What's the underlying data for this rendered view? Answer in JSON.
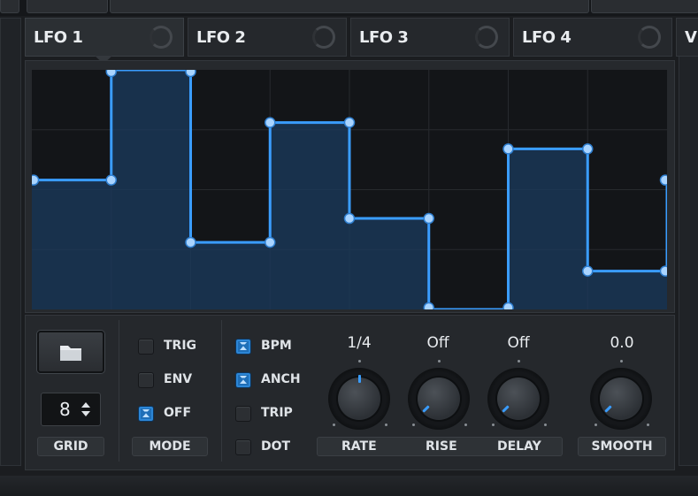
{
  "tabs": [
    {
      "label": "LFO 1",
      "active": true
    },
    {
      "label": "LFO 2",
      "active": false
    },
    {
      "label": "LFO 3",
      "active": false
    },
    {
      "label": "LFO 4",
      "active": false
    },
    {
      "label": "V",
      "active": false
    }
  ],
  "lfo_shape": {
    "points": [
      [
        0.0,
        0.54
      ],
      [
        0.125,
        0.54
      ],
      [
        0.125,
        1.0
      ],
      [
        0.25,
        1.0
      ],
      [
        0.25,
        0.28
      ],
      [
        0.375,
        0.28
      ],
      [
        0.375,
        0.78
      ],
      [
        0.5,
        0.78
      ],
      [
        0.5,
        0.38
      ],
      [
        0.625,
        0.38
      ],
      [
        0.625,
        0.0
      ],
      [
        0.75,
        0.0
      ],
      [
        0.75,
        0.67
      ],
      [
        0.875,
        0.67
      ],
      [
        0.875,
        0.16
      ],
      [
        1.0,
        0.16
      ],
      [
        1.0,
        0.54
      ]
    ]
  },
  "grid": {
    "value": "8",
    "label": "GRID"
  },
  "mode": {
    "label": "MODE",
    "options": [
      {
        "label": "TRIG",
        "checked": false
      },
      {
        "label": "ENV",
        "checked": false
      },
      {
        "label": "OFF",
        "checked": true
      }
    ]
  },
  "sync": {
    "options": [
      {
        "label": "BPM",
        "checked": true
      },
      {
        "label": "ANCH",
        "checked": true
      },
      {
        "label": "TRIP",
        "checked": false
      },
      {
        "label": "DOT",
        "checked": false
      }
    ]
  },
  "knobs": [
    {
      "value": "1/4",
      "label": "RATE"
    },
    {
      "value": "Off",
      "label": "RISE"
    },
    {
      "value": "Off",
      "label": "DELAY"
    },
    {
      "value": "0.0",
      "label": "SMOOTH"
    }
  ],
  "colors": {
    "accent": "#3a9dff",
    "fill": "#1b3b5e",
    "panel": "#25282c"
  },
  "icons": {
    "folder": "folder-icon",
    "stepper": "up-down-stepper-icon"
  }
}
